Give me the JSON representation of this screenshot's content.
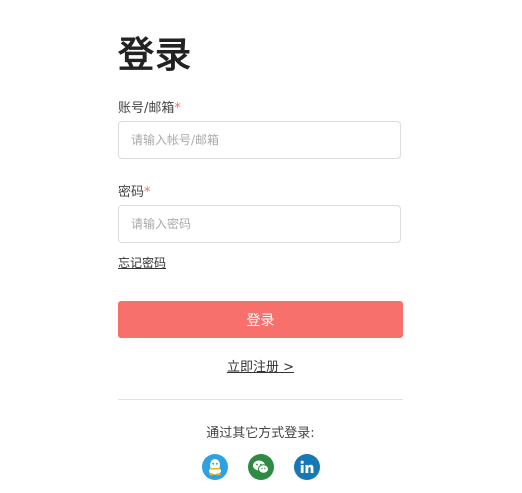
{
  "login": {
    "title": "登录",
    "account_label": "账号/邮箱",
    "account_required_mark": "*",
    "account_placeholder": "请输入帐号/邮箱",
    "password_label": "密码",
    "password_required_mark": "*",
    "password_placeholder": "请输入密码",
    "forgot_password": "忘记密码",
    "login_button": "登录",
    "register_link": "立即注册 >",
    "other_methods_text": "通过其它方式登录:"
  },
  "social": [
    {
      "name": "qq-icon",
      "color": "#2ea1e3"
    },
    {
      "name": "wechat-icon",
      "color": "#2f8a43"
    },
    {
      "name": "linkedin-icon",
      "color": "#1679b6"
    }
  ],
  "colors": {
    "accent": "#f7706b",
    "required": "#f06e6a"
  }
}
